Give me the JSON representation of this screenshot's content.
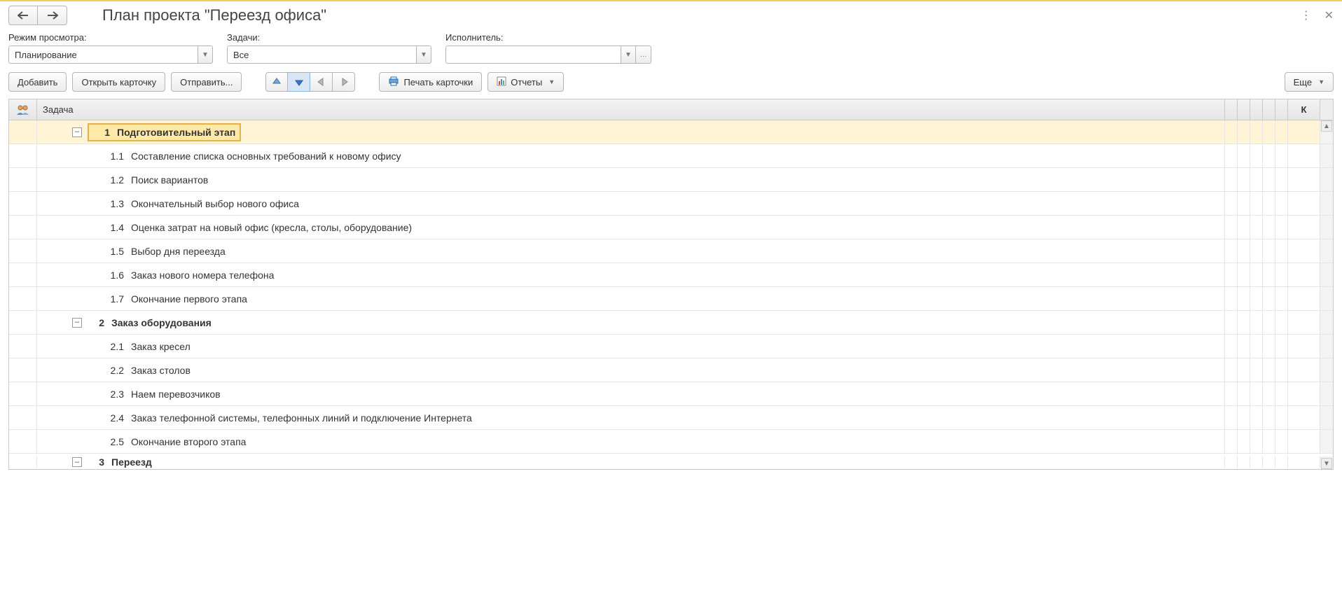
{
  "title": "План проекта \"Переезд офиса\"",
  "filters": {
    "viewMode": {
      "label": "Режим просмотра:",
      "value": "Планирование"
    },
    "tasks": {
      "label": "Задачи:",
      "value": "Все"
    },
    "executor": {
      "label": "Исполнитель:",
      "value": ""
    }
  },
  "toolbar": {
    "add": "Добавить",
    "openCard": "Открыть карточку",
    "send": "Отправить...",
    "printCard": "Печать карточки",
    "reports": "Отчеты",
    "more": "Еще"
  },
  "tableHeader": {
    "task": "Задача",
    "k": "К"
  },
  "rows": [
    {
      "type": "group",
      "num": "1",
      "name": "Подготовительный этап",
      "selected": true,
      "expanded": true,
      "level": 0
    },
    {
      "type": "item",
      "num": "1.1",
      "name": "Составление списка основных требований к новому офису",
      "level": 1
    },
    {
      "type": "item",
      "num": "1.2",
      "name": "Поиск вариантов",
      "level": 1
    },
    {
      "type": "item",
      "num": "1.3",
      "name": "Окончательный выбор нового офиса",
      "level": 1
    },
    {
      "type": "item",
      "num": "1.4",
      "name": "Оценка затрат на новый офис (кресла, столы, оборудование)",
      "level": 1
    },
    {
      "type": "item",
      "num": "1.5",
      "name": "Выбор дня переезда",
      "level": 1
    },
    {
      "type": "item",
      "num": "1.6",
      "name": "Заказ нового номера телефона",
      "level": 1
    },
    {
      "type": "item",
      "num": "1.7",
      "name": "Окончание первого этапа",
      "level": 1
    },
    {
      "type": "group",
      "num": "2",
      "name": "Заказ оборудования",
      "expanded": true,
      "level": 0
    },
    {
      "type": "item",
      "num": "2.1",
      "name": "Заказ кресел",
      "level": 1
    },
    {
      "type": "item",
      "num": "2.2",
      "name": "Заказ столов",
      "level": 1
    },
    {
      "type": "item",
      "num": "2.3",
      "name": "Наем перевозчиков",
      "level": 1
    },
    {
      "type": "item",
      "num": "2.4",
      "name": "Заказ телефонной системы, телефонных линий и подключение Интернета",
      "level": 1
    },
    {
      "type": "item",
      "num": "2.5",
      "name": "Окончание второго этапа",
      "level": 1
    },
    {
      "type": "group",
      "num": "3",
      "name": "Переезд",
      "expanded": true,
      "level": 0,
      "partial": true
    }
  ]
}
